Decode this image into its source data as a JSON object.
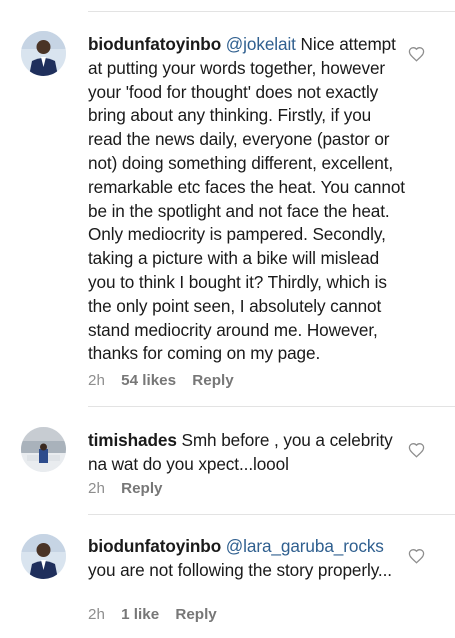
{
  "comments": [
    {
      "username": "biodunfatoyinbo",
      "mention": "@jokelait",
      "text": " Nice attempt at putting your words together, however your 'food for thought' does not exactly bring about any thinking. Firstly, if you read the news daily, everyone (pastor or not) doing something different, excellent, remarkable etc faces the heat. You cannot be in the spotlight and not face the heat. Only mediocrity is pampered. Secondly, taking a picture with a bike will mislead you to think I bought it? Thirdly, which is the only point seen, I absolutely cannot stand mediocrity around me. However, thanks for coming on my page.",
      "time": "2h",
      "likes": "54 likes",
      "reply": "Reply"
    },
    {
      "username": "timishades",
      "mention": "",
      "text": " Smh before , you a celebrity na wat do you xpect...loool",
      "time": "2h",
      "likes": "",
      "reply": "Reply"
    },
    {
      "username": "biodunfatoyinbo",
      "mention": "@lara_garuba_rocks",
      "text": " you are not following the story properly...",
      "time": "2h",
      "likes": "1 like",
      "reply": "Reply"
    }
  ],
  "icons": {
    "like": "heart-outline-icon"
  },
  "colors": {
    "mention": "#2f5f8f",
    "meta": "#8e8e8e"
  }
}
